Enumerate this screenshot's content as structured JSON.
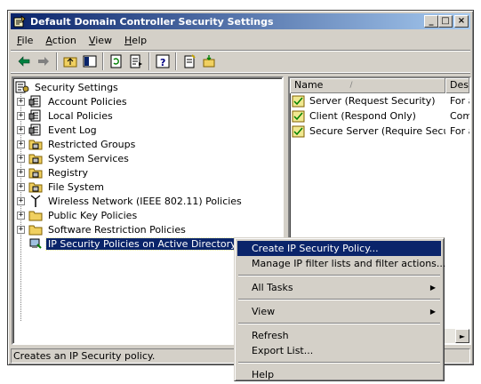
{
  "window": {
    "title": "Default Domain Controller Security Settings",
    "minimize": "_",
    "maximize": "□",
    "close": "×"
  },
  "menubar": {
    "items": [
      {
        "label": "File",
        "accel": "F",
        "rest": "ile"
      },
      {
        "label": "Action",
        "accel": "A",
        "rest": "ction"
      },
      {
        "label": "View",
        "accel": "V",
        "rest": "iew"
      },
      {
        "label": "Help",
        "accel": "H",
        "rest": "elp"
      }
    ]
  },
  "toolbar": {
    "icons": [
      "back-arrow-icon",
      "forward-arrow-icon",
      "up-folder-icon",
      "show-hide-tree-icon",
      "refresh-icon",
      "export-list-icon",
      "help-icon",
      "new-policy-icon",
      "properties-icon"
    ]
  },
  "tree": {
    "root": "Security Settings",
    "items": [
      {
        "label": "Account Policies",
        "icon": "policy-icon"
      },
      {
        "label": "Local Policies",
        "icon": "policy-icon"
      },
      {
        "label": "Event Log",
        "icon": "policy-icon"
      },
      {
        "label": "Restricted Groups",
        "icon": "lock-folder-icon"
      },
      {
        "label": "System Services",
        "icon": "lock-folder-icon"
      },
      {
        "label": "Registry",
        "icon": "lock-folder-icon"
      },
      {
        "label": "File System",
        "icon": "lock-folder-icon"
      },
      {
        "label": "Wireless Network (IEEE 802.11) Policies",
        "icon": "antenna-icon"
      },
      {
        "label": "Public Key Policies",
        "icon": "folder-icon"
      },
      {
        "label": "Software Restriction Policies",
        "icon": "folder-icon"
      },
      {
        "label": "IP Security Policies on Active Directory (omm",
        "icon": "ip-security-icon",
        "selected": true
      }
    ]
  },
  "list": {
    "columns": [
      "Name",
      "Desc"
    ],
    "sort_indicator": "/",
    "rows": [
      {
        "name": "Server (Request Security)",
        "desc": "For a"
      },
      {
        "name": "Client (Respond Only)",
        "desc": "Comr"
      },
      {
        "name": "Secure Server (Require Secu...",
        "desc": "For a"
      }
    ]
  },
  "context_menu": {
    "items": [
      {
        "label": "Create IP Security Policy...",
        "highlighted": true
      },
      {
        "label": "Manage IP filter lists and filter actions..."
      },
      {
        "sep": true
      },
      {
        "label": "All Tasks",
        "submenu": true
      },
      {
        "sep": true
      },
      {
        "label": "View",
        "submenu": true
      },
      {
        "sep": true
      },
      {
        "label": "Refresh"
      },
      {
        "label": "Export List..."
      },
      {
        "sep": true
      },
      {
        "label": "Help"
      }
    ]
  },
  "status": {
    "text": "Creates an IP Security policy."
  },
  "scrollbar": {
    "right_arrow": "►"
  }
}
